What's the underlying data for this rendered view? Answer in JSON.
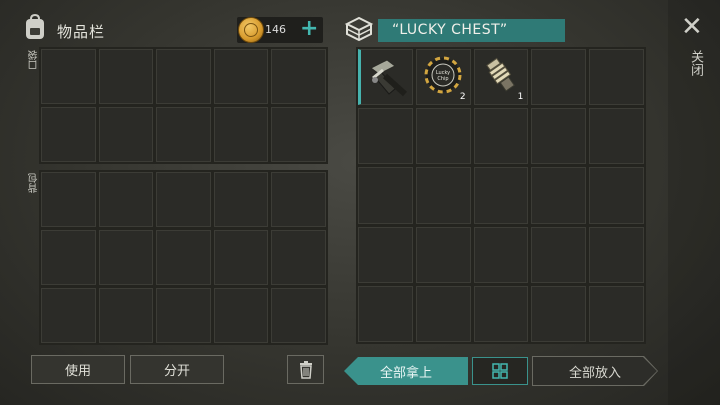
{
  "inventory": {
    "title": "物品栏",
    "coins": "146",
    "add_symbol": "+",
    "pocket_label": "口袋",
    "backpack_label": "背包"
  },
  "chest": {
    "name": "“LUCKY CHEST”",
    "items": [
      {
        "icon": "crossbow-icon",
        "count": ""
      },
      {
        "icon": "lucky-chip-icon",
        "count": "2"
      },
      {
        "icon": "spring-part-icon",
        "count": "1"
      }
    ]
  },
  "close": {
    "symbol": "✕",
    "label": "关闭"
  },
  "buttons": {
    "use": "使用",
    "split": "分开",
    "take_all": "全部拿上",
    "put_all": "全部放入"
  },
  "colors": {
    "accent": "#3a928c",
    "accent_light": "#43b7b0"
  }
}
